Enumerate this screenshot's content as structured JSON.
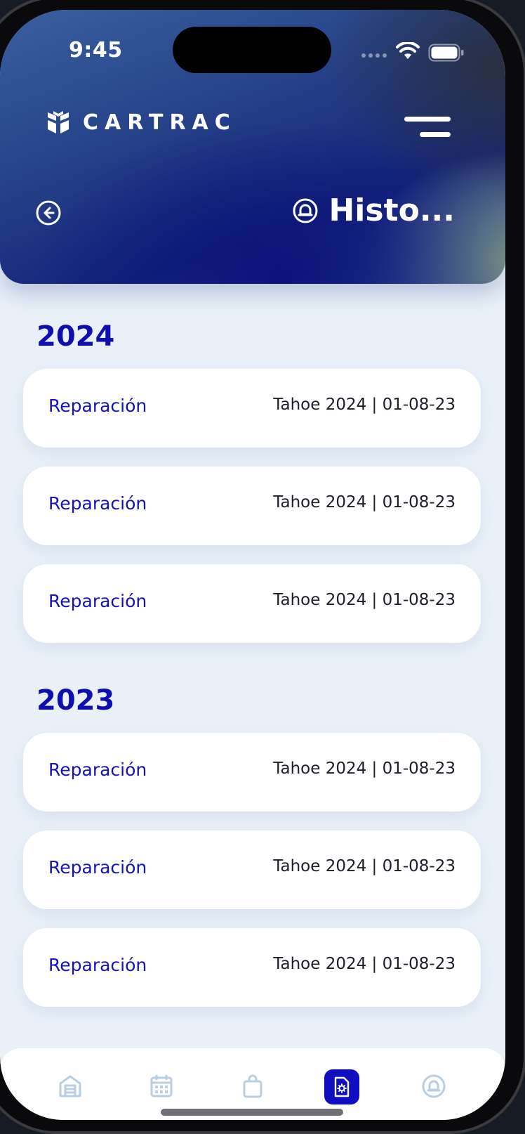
{
  "status_bar": {
    "time": "9:45"
  },
  "brand": {
    "name": "CARTRAC"
  },
  "header": {
    "title": "Histo..."
  },
  "sections": [
    {
      "year": "2024",
      "items": [
        {
          "label": "Reparación",
          "meta": "Tahoe 2024 | 01-08-23"
        },
        {
          "label": "Reparación",
          "meta": "Tahoe 2024 | 01-08-23"
        },
        {
          "label": "Reparación",
          "meta": "Tahoe 2024 | 01-08-23"
        }
      ]
    },
    {
      "year": "2023",
      "items": [
        {
          "label": "Reparación",
          "meta": "Tahoe 2024 | 01-08-23"
        },
        {
          "label": "Reparación",
          "meta": "Tahoe 2024 | 01-08-23"
        },
        {
          "label": "Reparación",
          "meta": "Tahoe 2024 | 01-08-23"
        }
      ]
    }
  ],
  "nav": [
    {
      "icon": "garage-icon",
      "active": false
    },
    {
      "icon": "calendar-icon",
      "active": false
    },
    {
      "icon": "shopping-bag-icon",
      "active": false
    },
    {
      "icon": "document-gear-icon",
      "active": true
    },
    {
      "icon": "notification-icon",
      "active": false
    }
  ],
  "colors": {
    "accent": "#0f0fbf",
    "year_text": "#0f0fb0",
    "item_label": "#1414b4",
    "background": "#e9f0f8",
    "nav_inactive": "#b9cde3"
  }
}
